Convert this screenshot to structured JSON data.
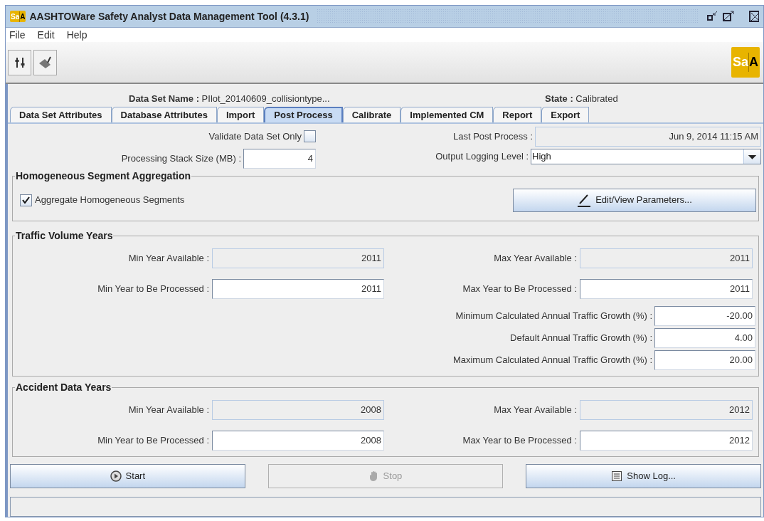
{
  "window": {
    "title": "AASHTOWare Safety Analyst Data Management Tool (4.3.1)",
    "logo_left": "Sa",
    "logo_right": "A"
  },
  "menu": [
    "File",
    "Edit",
    "Help"
  ],
  "toolbar_logo": {
    "left": "Sa",
    "right": "A"
  },
  "header": {
    "name_label": "Data Set Name :",
    "name_value": "PIlot_20140609_collisiontype...",
    "state_label": "State :",
    "state_value": "Calibrated"
  },
  "tabs": [
    {
      "label": "Data Set Attributes",
      "selected": false
    },
    {
      "label": "Database Attributes",
      "selected": false
    },
    {
      "label": "Import",
      "selected": false
    },
    {
      "label": "Post Process",
      "selected": true
    },
    {
      "label": "Calibrate",
      "selected": false
    },
    {
      "label": "Implemented CM",
      "selected": false
    },
    {
      "label": "Report",
      "selected": false
    },
    {
      "label": "Export",
      "selected": false
    }
  ],
  "validate": {
    "label": "Validate Data Set Only",
    "checked": false
  },
  "stack": {
    "label": "Processing Stack Size (MB) :",
    "value": "4"
  },
  "last_post": {
    "label": "Last Post Process :",
    "value": "Jun 9, 2014 11:15 AM"
  },
  "logging": {
    "label": "Output Logging Level :",
    "value": "High"
  },
  "aggregation": {
    "title": "Homogeneous Segment Aggregation",
    "checkbox": {
      "label": "Aggregate Homogeneous Segments",
      "checked": true
    },
    "button": "Edit/View Parameters..."
  },
  "traffic": {
    "title": "Traffic Volume Years",
    "fields": [
      {
        "label": "Min Year Available :",
        "value": "2011",
        "editable": false
      },
      {
        "label": "Max Year Available :",
        "value": "2011",
        "editable": false
      },
      {
        "label": "Min Year to Be Processed :",
        "value": "2011",
        "editable": true
      },
      {
        "label": "Max Year to Be Processed :",
        "value": "2011",
        "editable": true
      }
    ],
    "growth": [
      {
        "label": "Minimum Calculated Annual Traffic Growth (%) :",
        "value": "-20.00"
      },
      {
        "label": "Default Annual Traffic Growth (%) :",
        "value": "4.00"
      },
      {
        "label": "Maximum Calculated Annual Traffic Growth (%) :",
        "value": "20.00"
      }
    ]
  },
  "accident": {
    "title": "Accident Data Years",
    "fields": [
      {
        "label": "Min Year Available :",
        "value": "2008",
        "editable": false
      },
      {
        "label": "Max Year Available :",
        "value": "2012",
        "editable": false
      },
      {
        "label": "Min Year to Be Processed :",
        "value": "2008",
        "editable": true
      },
      {
        "label": "Max Year to Be Processed :",
        "value": "2012",
        "editable": true
      }
    ]
  },
  "buttons": [
    {
      "label": "Start",
      "kind": "start",
      "disabled": false
    },
    {
      "label": "Stop",
      "kind": "stop",
      "disabled": true
    },
    {
      "label": "Show Log...",
      "kind": "log",
      "disabled": false
    }
  ]
}
